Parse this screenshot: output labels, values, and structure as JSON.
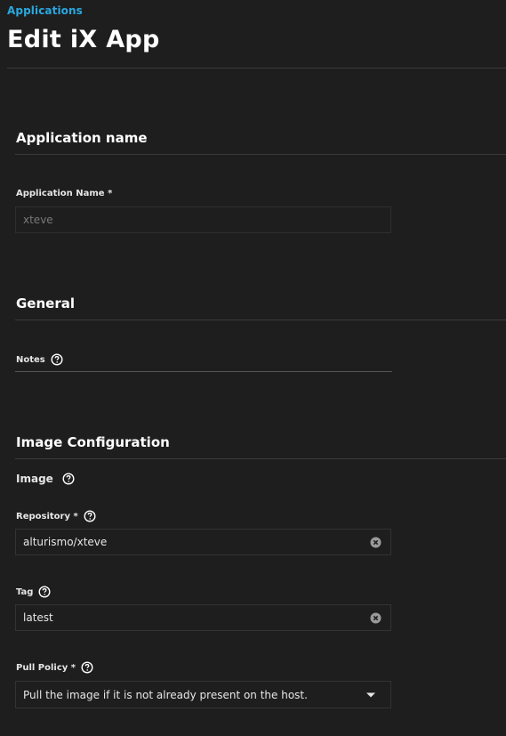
{
  "breadcrumb": "Applications",
  "page_title": "Edit iX App",
  "sections": {
    "app_name": {
      "title": "Application name",
      "field_label": "Application Name *",
      "field_value": "xteve"
    },
    "general": {
      "title": "General",
      "notes_label": "Notes"
    },
    "image_config": {
      "title": "Image Configuration",
      "image_label": "Image",
      "repository_label": "Repository *",
      "repository_value": "alturismo/xteve",
      "tag_label": "Tag",
      "tag_value": "latest",
      "pull_policy_label": "Pull Policy *",
      "pull_policy_value": "Pull the image if it is not already present on the host."
    }
  },
  "icons": {
    "help": "help-circle-icon",
    "clear": "clear-circle-icon",
    "dropdown": "caret-down-icon"
  },
  "colors": {
    "background": "#1e1e1e",
    "accent": "#2aa8e0",
    "text": "#e6e6e6",
    "divider": "#3a3a3a"
  }
}
